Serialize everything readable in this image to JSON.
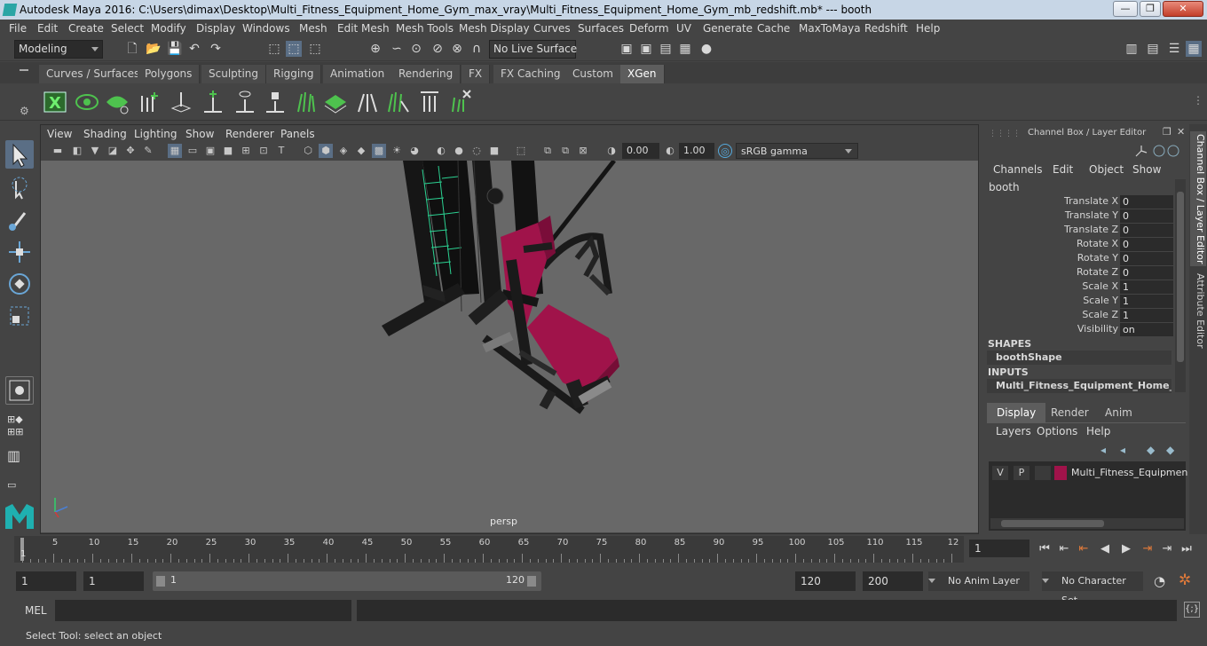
{
  "window": {
    "title": "Autodesk Maya 2016: C:\\Users\\dimax\\Desktop\\Multi_Fitness_Equipment_Home_Gym_max_vray\\Multi_Fitness_Equipment_Home_Gym_mb_redshift.mb*   ---   booth",
    "minimize_label": "—",
    "restore_label": "❐",
    "close_label": "✕"
  },
  "menubar": [
    "File",
    "Edit",
    "Create",
    "Select",
    "Modify",
    "Display",
    "Windows",
    "Mesh",
    "Edit Mesh",
    "Mesh Tools",
    "Mesh Display",
    "Curves",
    "Surfaces",
    "Deform",
    "UV",
    "Generate",
    "Cache",
    "MaxToMaya",
    "Redshift",
    "Help"
  ],
  "statusline": {
    "mode": "Modeling",
    "live_surface": "No Live Surface"
  },
  "shelf_tabs": [
    "Curves / Surfaces",
    "Polygons",
    "Sculpting",
    "Rigging",
    "Animation",
    "Rendering",
    "FX",
    "FX Caching",
    "Custom",
    "XGen"
  ],
  "active_shelf_tab": "XGen",
  "viewport": {
    "menu": [
      "View",
      "Shading",
      "Lighting",
      "Show",
      "Renderer",
      "Panels"
    ],
    "exposure": "0.00",
    "gamma": "1.00",
    "color_space": "sRGB gamma",
    "camera_label": "persp",
    "model_colors": {
      "frame": "#151515",
      "seat": "#a0134a",
      "accent": "#2ee6a0",
      "viewport_bg": "#686868"
    }
  },
  "channel_box": {
    "title": "Channel Box / Layer Editor",
    "menu": [
      "Channels",
      "Edit",
      "Object",
      "Show"
    ],
    "node": "booth",
    "attributes": [
      {
        "name": "Translate X",
        "value": "0"
      },
      {
        "name": "Translate Y",
        "value": "0"
      },
      {
        "name": "Translate Z",
        "value": "0"
      },
      {
        "name": "Rotate X",
        "value": "0"
      },
      {
        "name": "Rotate Y",
        "value": "0"
      },
      {
        "name": "Rotate Z",
        "value": "0"
      },
      {
        "name": "Scale X",
        "value": "1"
      },
      {
        "name": "Scale Y",
        "value": "1"
      },
      {
        "name": "Scale Z",
        "value": "1"
      },
      {
        "name": "Visibility",
        "value": "on"
      }
    ],
    "shapes_label": "SHAPES",
    "shape": "boothShape",
    "inputs_label": "INPUTS",
    "input": "Multi_Fitness_Equipment_Home_Gym"
  },
  "layer_editor": {
    "tabs": [
      "Display",
      "Render",
      "Anim"
    ],
    "active_tab": "Display",
    "menu": [
      "Layers",
      "Options",
      "Help"
    ],
    "layer": {
      "v": "V",
      "p": "P",
      "color": "#a0134a",
      "name": "Multi_Fitness_Equipmen"
    }
  },
  "side_tabs": [
    "Channel Box / Layer Editor",
    "Attribute Editor"
  ],
  "timeline": {
    "ticks": [
      "5",
      "10",
      "15",
      "20",
      "25",
      "30",
      "35",
      "40",
      "45",
      "50",
      "55",
      "60",
      "65",
      "70",
      "75",
      "80",
      "85",
      "90",
      "95",
      "100",
      "105",
      "110",
      "115",
      "12"
    ],
    "current_frame_marker": "1",
    "current_frame": "1"
  },
  "range": {
    "start": "1",
    "playback_start": "1",
    "range_start_label": "1",
    "range_end_label": "120",
    "playback_end": "120",
    "end": "200",
    "anim_layer": "No Anim Layer",
    "character_set": "No Character Set"
  },
  "mel": {
    "label": "MEL"
  },
  "helpline": "Select Tool: select an object"
}
